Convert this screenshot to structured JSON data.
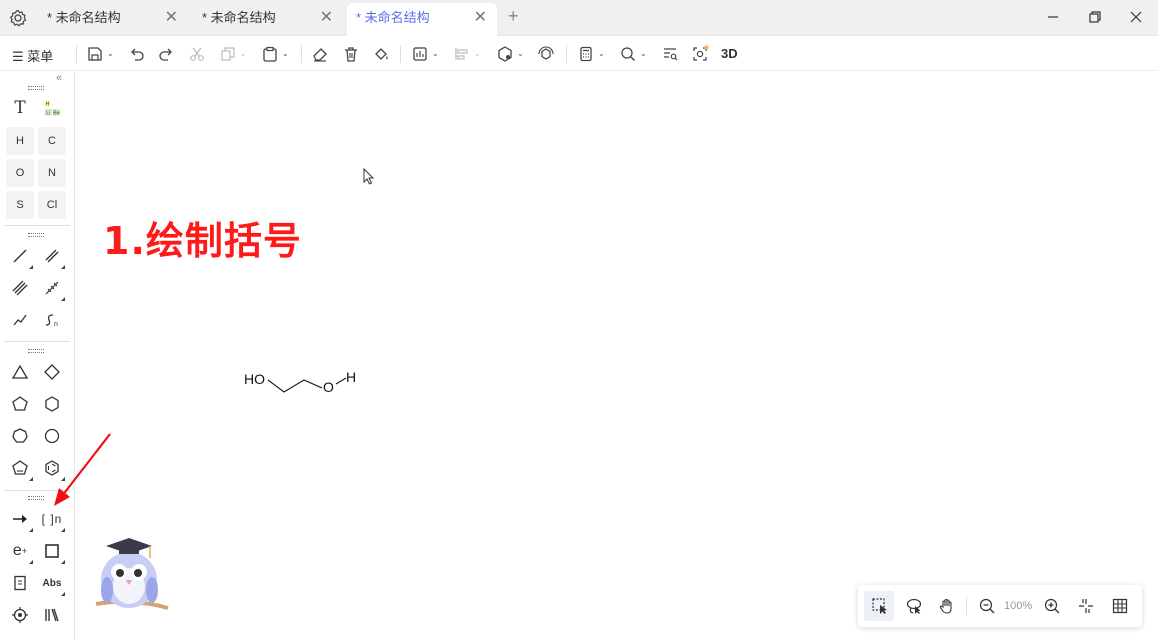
{
  "tabs": [
    {
      "label": "* 未命名结构",
      "active": false
    },
    {
      "label": "* 未命名结构",
      "active": false
    },
    {
      "label": "* 未命名结构",
      "active": true
    }
  ],
  "toolbar": {
    "menu_label": "菜单",
    "three_d_label": "3D"
  },
  "sidebar": {
    "elements": [
      "H",
      "C",
      "O",
      "N",
      "S",
      "Cl"
    ],
    "periodic_table_icon": {
      "h": "H",
      "li": "Li",
      "be": "Be"
    },
    "abs_label": "Abs",
    "charge_label": "e",
    "bracket_label": "[ ]n",
    "chain_label": "n"
  },
  "canvas": {
    "heading": "1.绘制括号",
    "molecule": {
      "label_ho": "HO",
      "label_o": "O",
      "label_h": "H"
    }
  },
  "zoom": {
    "value": "100%"
  },
  "colors": {
    "accent": "#5b6ee8",
    "heading": "#ff1a1a",
    "arrow": "#ee1111"
  }
}
